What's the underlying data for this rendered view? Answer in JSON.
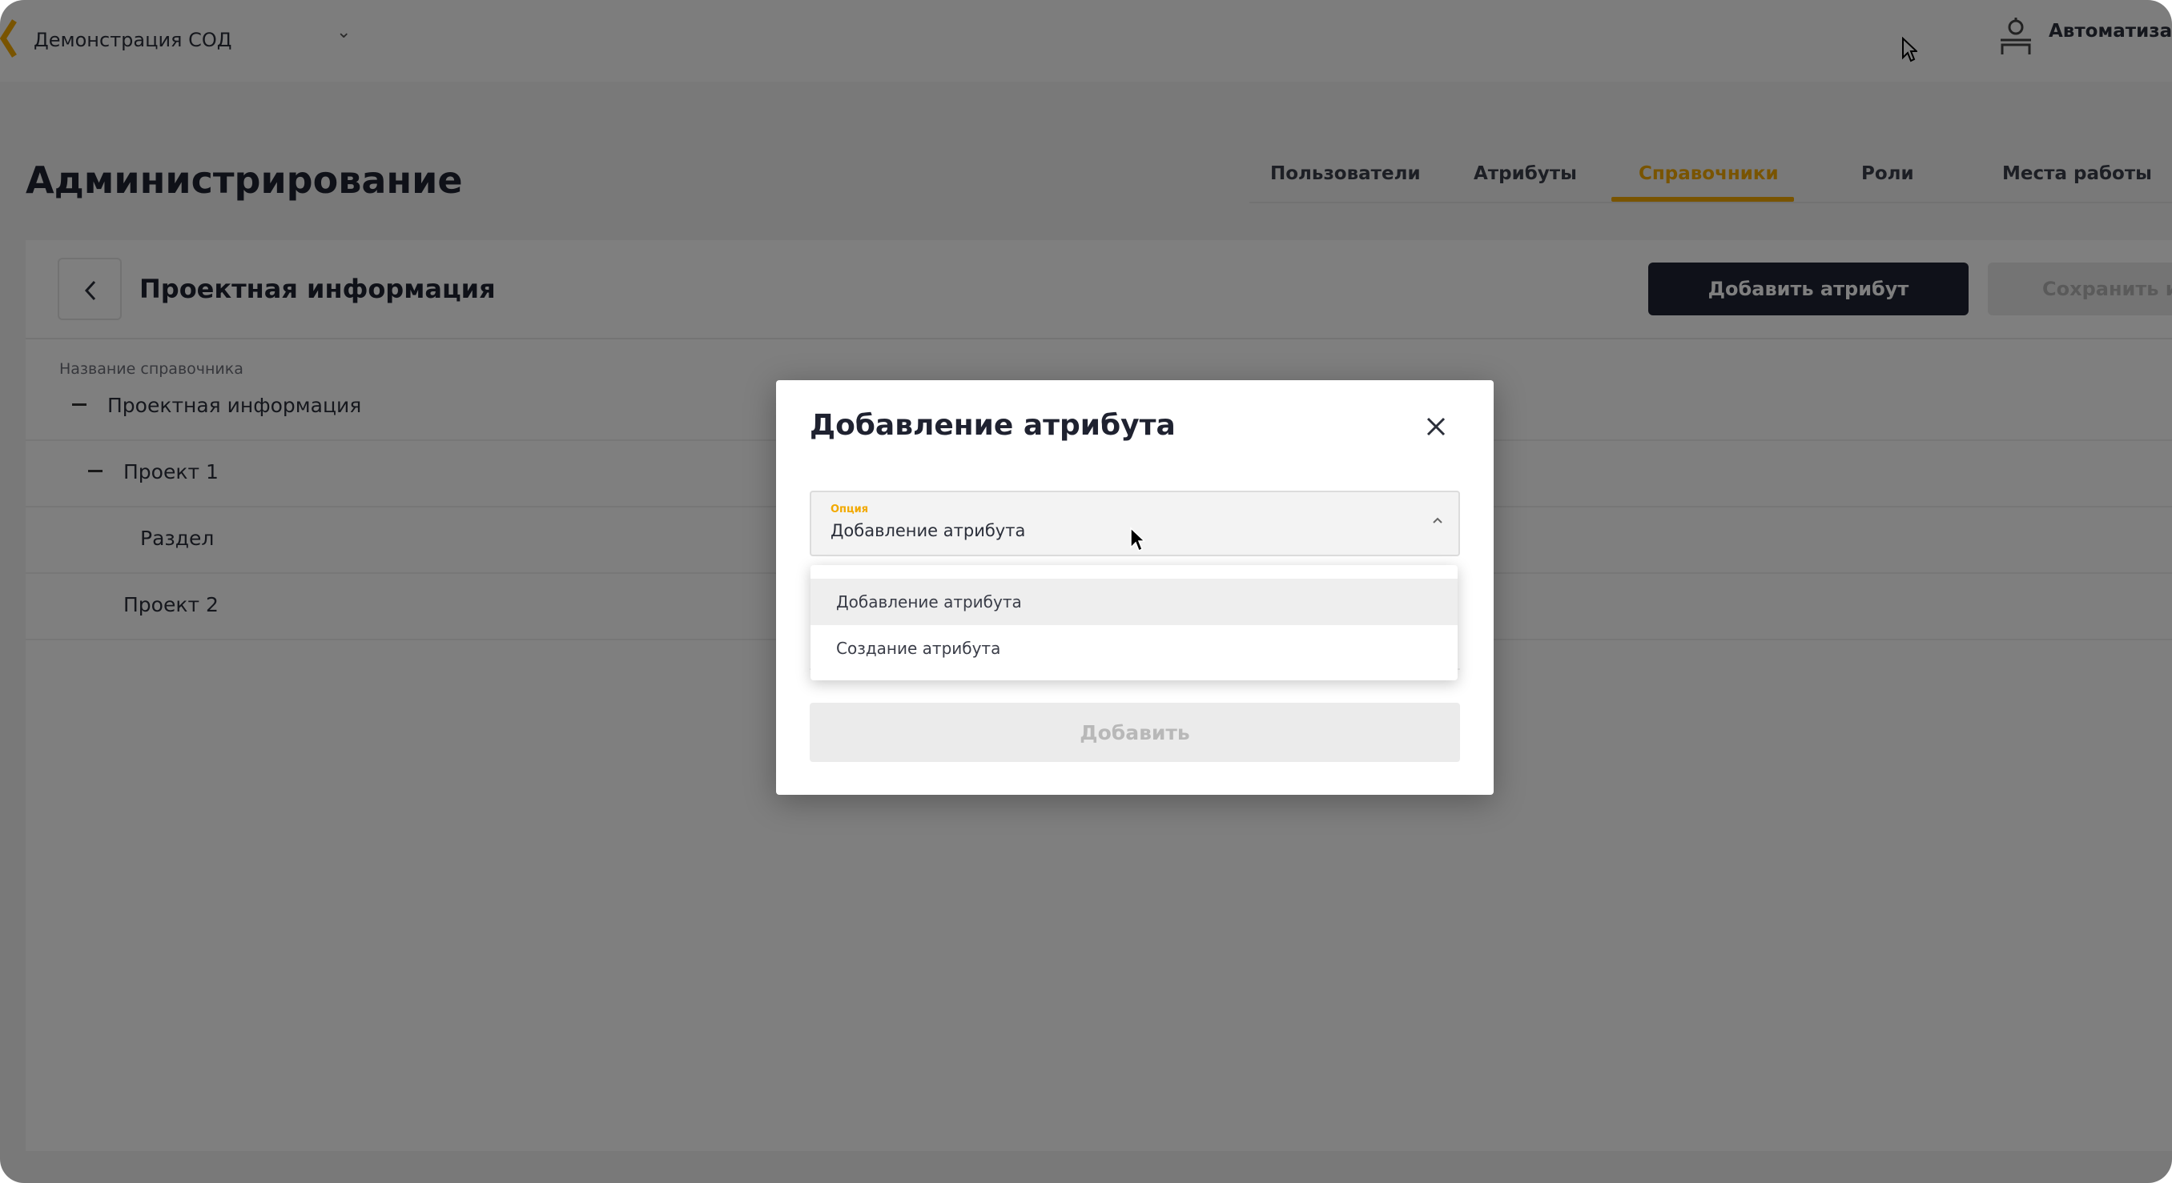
{
  "topbar": {
    "workspace": "Демонстрация СОД",
    "user_name": "Автоматизац"
  },
  "page": {
    "title": "Администрирование",
    "tabs": [
      {
        "label": "Пользователи",
        "active": false
      },
      {
        "label": "Атрибуты",
        "active": false
      },
      {
        "label": "Справочники",
        "active": true
      },
      {
        "label": "Роли",
        "active": false
      },
      {
        "label": "Места работы",
        "active": false
      }
    ]
  },
  "panel": {
    "title": "Проектная информация",
    "add_attribute_label": "Добавить атрибут",
    "save_label": "Сохранить из",
    "column_header": "Название справочника",
    "tree": [
      {
        "label": "Проектная информация",
        "expanded": true
      },
      {
        "label": "Проект 1",
        "expanded": true
      },
      {
        "label": "Раздел",
        "expanded": false
      },
      {
        "label": "Проект 2",
        "expanded": false
      }
    ]
  },
  "modal": {
    "title": "Добавление атрибута",
    "select": {
      "label": "Опция",
      "value": "Добавление атрибута",
      "options": [
        "Добавление атрибута",
        "Создание атрибута"
      ],
      "highlighted_index": 0
    },
    "add_label": "Добавить"
  },
  "colors": {
    "accent": "#f2a900",
    "primary_button": "#1e2233",
    "overlay": "rgba(0,0,0,0.5)"
  },
  "icons": [
    "logo-icon",
    "chevron-down-icon",
    "user-icon",
    "back-arrow-icon",
    "close-icon",
    "chevron-up-icon",
    "cursor-icon"
  ]
}
